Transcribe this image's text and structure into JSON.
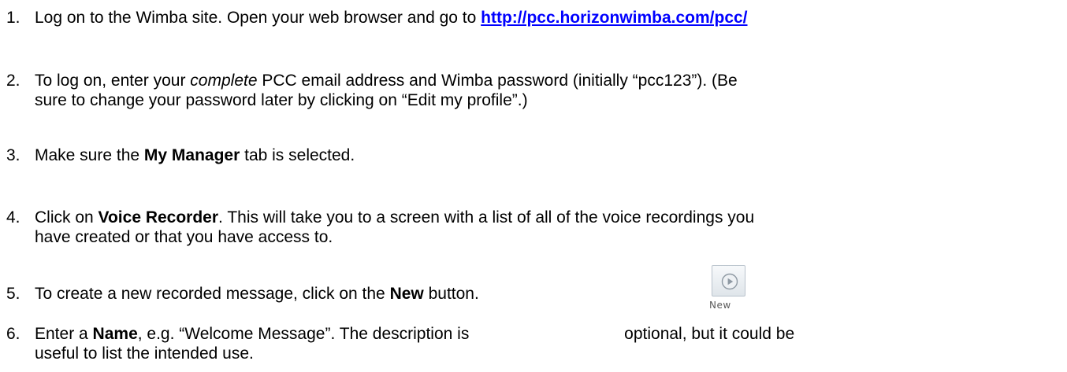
{
  "steps": [
    {
      "number": "1.",
      "text_a": "Log on to the Wimba site.  Open your web browser and go to ",
      "link": "http://pcc.horizonwimba.com/pcc/"
    },
    {
      "number": "2.",
      "text_a": "To log on, enter your ",
      "emphasis": "complete",
      "text_b": " PCC email address and Wimba password (initially “pcc123”).  (Be",
      "text_c": "sure to change your password later by clicking on “Edit my profile”.)"
    },
    {
      "number": "3.",
      "text_a": "Make sure the ",
      "bold": "My Manager",
      "text_b": " tab is selected."
    },
    {
      "number": "4.",
      "text_a": "Click on ",
      "bold": "Voice Recorder",
      "text_b": ". This will take you to a screen with a list of all of the voice recordings you",
      "text_c": "have created or that you have access to."
    },
    {
      "number": "5.",
      "text_a": "To create a new recorded message, click on the ",
      "bold": "New",
      "text_b": " button."
    },
    {
      "number": "6.",
      "text_a": "Enter a ",
      "bold": "Name",
      "text_b": ", e.g. “Welcome Message”.  The description is ",
      "text_c": "optional, but it could be",
      "text_d": "useful to list the intended use."
    }
  ],
  "new_button": {
    "label": "New",
    "icon": "play-circle-icon"
  },
  "colors": {
    "link": "#0000ff",
    "text": "#000000"
  }
}
